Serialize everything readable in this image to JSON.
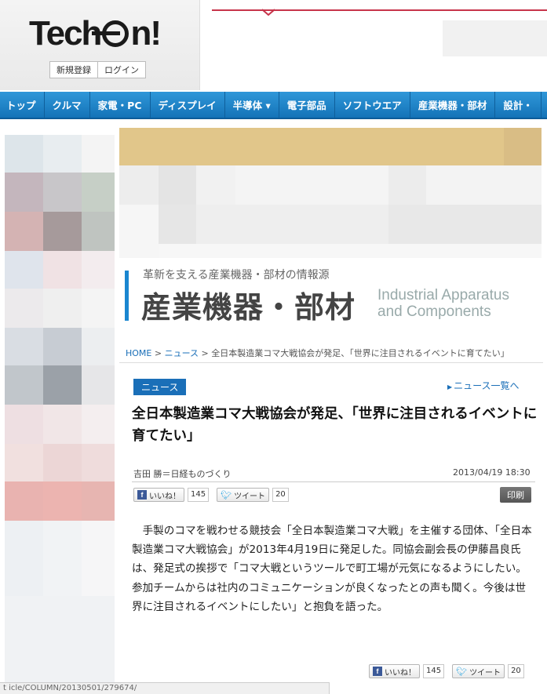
{
  "brand": {
    "logo_text_left": "Tech",
    "logo_text_right": "n!"
  },
  "auth": {
    "register": "新規登録",
    "login": "ログイン"
  },
  "nav": [
    "トップ",
    "クルマ",
    "家電・PC",
    "ディスプレイ",
    "半導体 ▾",
    "電子部品",
    "ソフトウエア",
    "産業機器・部材",
    "設計・"
  ],
  "section": {
    "tagline": "革新を支える産業機器・部材の情報源",
    "title": "産業機器・部材",
    "title_en_line1": "Industrial Apparatus",
    "title_en_line2": "and Components"
  },
  "breadcrumb": {
    "home": "HOME",
    "sep": ">",
    "news": "ニュース",
    "current": "全日本製造業コマ大戦協会が発足、「世界に注目されるイベントに育てたい」"
  },
  "article": {
    "category": "ニュース",
    "list_link": "ニュース一覧へ",
    "title": "全日本製造業コマ大戦協会が発足、「世界に注目されるイベントに育てたい」",
    "author": "吉田 勝＝日経ものづくり",
    "date": "2013/04/19 18:30",
    "print": "印刷",
    "body": "手製のコマを戦わせる競技会「全日本製造業コマ大戦」を主催する団体、「全日本製造業コマ大戦協会」が2013年4月19日に発足した。同協会副会長の伊藤昌良氏は、発足式の挨拶で「コマ大戦というツールで町工場が元気になるようにしたい。参加チームからは社内のコミュニケーションが良くなったとの声も聞く。今後は世界に注目されるイベントにしたい」と抱負を語った。"
  },
  "social": {
    "like_label": "いいね！",
    "like_count": "145",
    "tweet_label": "ツイート",
    "tweet_count": "20"
  },
  "status_bar": "t                                    icle/COLUMN/20130501/279674/",
  "colors": {
    "nav": "#1a7fc4",
    "accent": "#1a6fb8",
    "header_line": "#c7344a",
    "banner": "#e1c68a"
  }
}
